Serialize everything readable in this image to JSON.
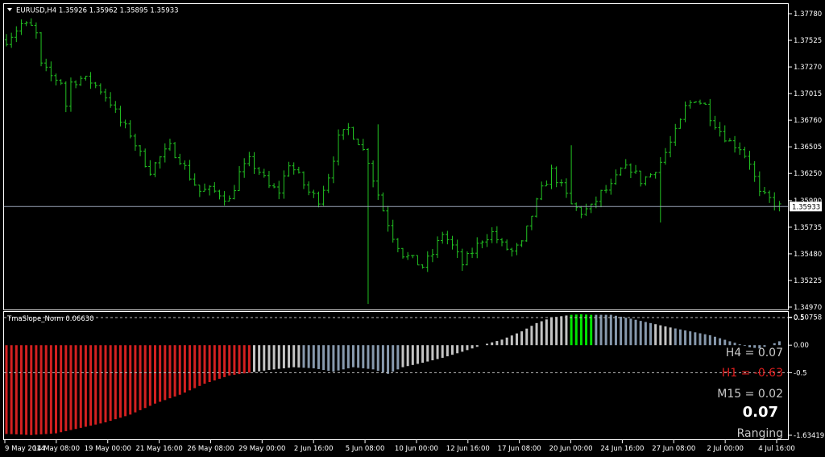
{
  "window": {
    "symbol_header": "EURUSD,H4  1.35926 1.35962 1.35895 1.35933"
  },
  "indicator": {
    "name": "TmaSlope_Norm 0.06630",
    "h4_text": "H4 = 0.07",
    "h1_text": "H1 = -0.63",
    "m15_text": "M15 = 0.02",
    "current_value": "0.07",
    "state": "Ranging"
  },
  "colors": {
    "background": "#000000",
    "bull_candle": "#22c322",
    "hist_red": "#d42020",
    "hist_light": "#c4c4c4",
    "hist_steel": "#8799ad",
    "hist_green": "#00e600",
    "h4_color": "#c8c8c8",
    "h1_color": "#e01e1e",
    "m15_color": "#c8c8c8",
    "value_color": "#ffffff",
    "state_color": "#c8c8c8"
  },
  "chart_data": [
    {
      "type": "candlestick",
      "title": "EURUSD,H4",
      "ylim": [
        1.3497,
        1.3778
      ],
      "yticks": [
        "1.37780",
        "1.37525",
        "1.37270",
        "1.37015",
        "1.36760",
        "1.36505",
        "1.36250",
        "1.35990",
        "1.35735",
        "1.35480",
        "1.35225",
        "1.34970"
      ],
      "xticks": [
        "9 May 2014",
        "14 May 08:00",
        "19 May 00:00",
        "21 May 16:00",
        "26 May 08:00",
        "29 May 00:00",
        "2 Jun 16:00",
        "5 Jun 08:00",
        "10 Jun 00:00",
        "12 Jun 16:00",
        "17 Jun 08:00",
        "20 Jun 00:00",
        "24 Jun 16:00",
        "27 Jun 08:00",
        "2 Jul 00:00",
        "4 Jul 16:00"
      ],
      "current_price": "1.35933",
      "close_path": [
        [
          0,
          1.3753
        ],
        [
          3,
          1.3768
        ],
        [
          5,
          1.3765
        ],
        [
          6,
          1.3758
        ],
        [
          7,
          1.3728
        ],
        [
          9,
          1.3718
        ],
        [
          11,
          1.3713
        ],
        [
          12,
          1.369
        ],
        [
          13,
          1.3712
        ],
        [
          15,
          1.3716
        ],
        [
          17,
          1.3713
        ],
        [
          19,
          1.3705
        ],
        [
          21,
          1.3693
        ],
        [
          23,
          1.3674
        ],
        [
          25,
          1.3663
        ],
        [
          27,
          1.3643
        ],
        [
          29,
          1.3628
        ],
        [
          31,
          1.364
        ],
        [
          33,
          1.365
        ],
        [
          35,
          1.3639
        ],
        [
          37,
          1.3622
        ],
        [
          39,
          1.3608
        ],
        [
          41,
          1.3609
        ],
        [
          43,
          1.3606
        ],
        [
          45,
          1.3599
        ],
        [
          47,
          1.3625
        ],
        [
          49,
          1.3637
        ],
        [
          51,
          1.3627
        ],
        [
          53,
          1.3612
        ],
        [
          55,
          1.3608
        ],
        [
          57,
          1.3635
        ],
        [
          59,
          1.3622
        ],
        [
          61,
          1.3607
        ],
        [
          63,
          1.36
        ],
        [
          65,
          1.3623
        ],
        [
          67,
          1.3658
        ],
        [
          69,
          1.3668
        ],
        [
          71,
          1.3656
        ],
        [
          73,
          1.3638
        ],
        [
          74,
          1.362
        ],
        [
          76,
          1.359
        ],
        [
          78,
          1.3565
        ],
        [
          80,
          1.3548
        ],
        [
          82,
          1.3542
        ],
        [
          84,
          1.3536
        ],
        [
          86,
          1.3548
        ],
        [
          88,
          1.3568
        ],
        [
          90,
          1.3555
        ],
        [
          92,
          1.3538
        ],
        [
          94,
          1.355
        ],
        [
          96,
          1.3562
        ],
        [
          98,
          1.3568
        ],
        [
          100,
          1.3556
        ],
        [
          102,
          1.355
        ],
        [
          104,
          1.3557
        ],
        [
          106,
          1.3585
        ],
        [
          108,
          1.3609
        ],
        [
          110,
          1.3627
        ],
        [
          112,
          1.3612
        ],
        [
          114,
          1.3595
        ],
        [
          116,
          1.3588
        ],
        [
          118,
          1.3592
        ],
        [
          120,
          1.3606
        ],
        [
          122,
          1.3612
        ],
        [
          124,
          1.3628
        ],
        [
          126,
          1.363
        ],
        [
          128,
          1.3618
        ],
        [
          130,
          1.3624
        ],
        [
          132,
          1.3636
        ],
        [
          134,
          1.3654
        ],
        [
          136,
          1.3674
        ],
        [
          137,
          1.3688
        ],
        [
          139,
          1.3697
        ],
        [
          141,
          1.369
        ],
        [
          142,
          1.368
        ],
        [
          144,
          1.3666
        ],
        [
          146,
          1.3655
        ],
        [
          148,
          1.365
        ],
        [
          150,
          1.3636
        ],
        [
          152,
          1.3605
        ],
        [
          154,
          1.36
        ],
        [
          156,
          1.3593
        ]
      ]
    },
    {
      "type": "bar",
      "title": "TmaSlope_Norm 0.06630",
      "ylim": [
        -1.63419,
        0.5
      ],
      "yticks": [
        "0.50758",
        "0.5",
        "0.00",
        "-0.5",
        "-1.63419"
      ],
      "levels": [
        0.5,
        -0.5
      ],
      "slope_path": [
        [
          0,
          -1.61
        ],
        [
          5,
          -1.63
        ],
        [
          10,
          -1.6
        ],
        [
          15,
          -1.5
        ],
        [
          20,
          -1.4
        ],
        [
          25,
          -1.26
        ],
        [
          30,
          -1.06
        ],
        [
          35,
          -0.9
        ],
        [
          40,
          -0.7
        ],
        [
          45,
          -0.55
        ],
        [
          49,
          -0.5
        ],
        [
          53,
          -0.45
        ],
        [
          58,
          -0.4
        ],
        [
          62,
          -0.42
        ],
        [
          66,
          -0.48
        ],
        [
          70,
          -0.4
        ],
        [
          74,
          -0.44
        ],
        [
          77,
          -0.52
        ],
        [
          80,
          -0.4
        ],
        [
          84,
          -0.32
        ],
        [
          88,
          -0.23
        ],
        [
          92,
          -0.12
        ],
        [
          96,
          0.0
        ],
        [
          100,
          0.1
        ],
        [
          104,
          0.25
        ],
        [
          107,
          0.4
        ],
        [
          110,
          0.5
        ],
        [
          114,
          0.55
        ],
        [
          116,
          0.56
        ],
        [
          118,
          0.55
        ],
        [
          122,
          0.55
        ],
        [
          126,
          0.48
        ],
        [
          130,
          0.4
        ],
        [
          134,
          0.32
        ],
        [
          138,
          0.25
        ],
        [
          142,
          0.18
        ],
        [
          146,
          0.07
        ],
        [
          150,
          -0.04
        ],
        [
          152,
          -0.06
        ],
        [
          154,
          0.0
        ],
        [
          156,
          0.07
        ]
      ],
      "color_runs": [
        {
          "from": 0,
          "to": 49,
          "color": "hist_red"
        },
        {
          "from": 50,
          "to": 59,
          "color": "hist_light"
        },
        {
          "from": 60,
          "to": 79,
          "color": "hist_steel"
        },
        {
          "from": 80,
          "to": 113,
          "color": "hist_light"
        },
        {
          "from": 114,
          "to": 118,
          "color": "hist_green"
        },
        {
          "from": 119,
          "to": 130,
          "color": "hist_steel"
        },
        {
          "from": 131,
          "to": 134,
          "color": "hist_light"
        },
        {
          "from": 135,
          "to": 156,
          "color": "hist_steel"
        }
      ]
    }
  ]
}
